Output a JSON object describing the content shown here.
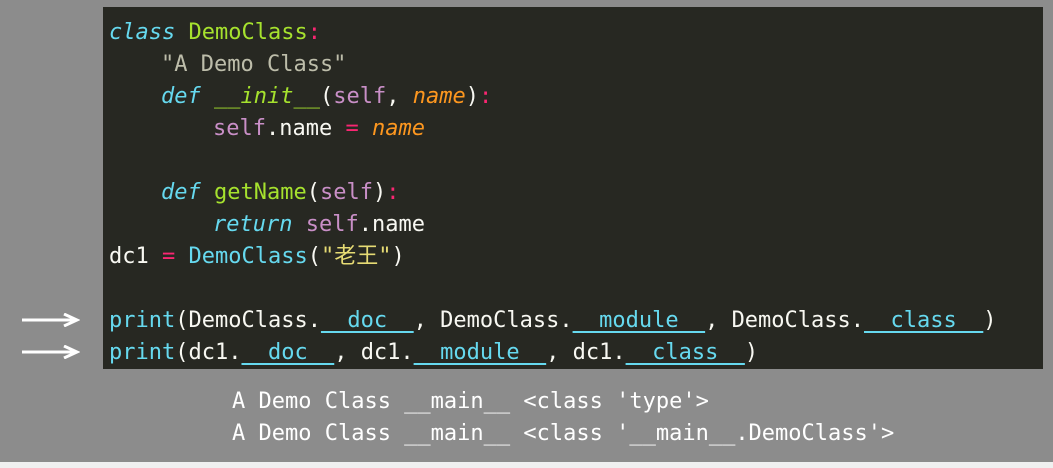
{
  "code": {
    "l1": {
      "kw": "class",
      "name": "DemoClass",
      "colon": ":"
    },
    "l2": {
      "docstring": "\"A Demo Class\""
    },
    "l3": {
      "kw": "def",
      "name": "__init__",
      "open": "(",
      "self": "self",
      ",": ", ",
      "param": "name",
      "close": ")",
      "colon": ":"
    },
    "l4": {
      "self": "self",
      "attr": ".name",
      "eq": " = ",
      "param": "name"
    },
    "l5": {
      "kw": "def",
      "name": "getName",
      "open": "(",
      "self": "self",
      "close": ")",
      "colon": ":"
    },
    "l6": {
      "kw": "return",
      "self": "self",
      "attr": ".name"
    },
    "l7": {
      "var": "dc1",
      "eq": " = ",
      "call": "DemoClass",
      "open": "(",
      "str": "\"老王\"",
      "close": ")"
    },
    "l8": {
      "fn": "print",
      "open": "(",
      "a1": "DemoClass.",
      "d1": "__doc__",
      "s1": ", ",
      "a2": "DemoClass.",
      "d2": "__module__",
      "s2": ", ",
      "a3": "DemoClass.",
      "d3": "__class__",
      "close": ")"
    },
    "l9": {
      "fn": "print",
      "open": "(",
      "a1": "dc1.",
      "d1": "__doc__",
      "s1": ", ",
      "a2": "dc1.",
      "d2": "__module__",
      "s2": ", ",
      "a3": "dc1.",
      "d3": "__class__",
      "close": ")"
    }
  },
  "output": {
    "line1": "A Demo Class __main__ <class 'type'>",
    "line2": "A Demo Class __main__ <class '__main__.DemoClass'>"
  },
  "icons": [
    "arrow-right-icon",
    "arrow-right-icon"
  ]
}
